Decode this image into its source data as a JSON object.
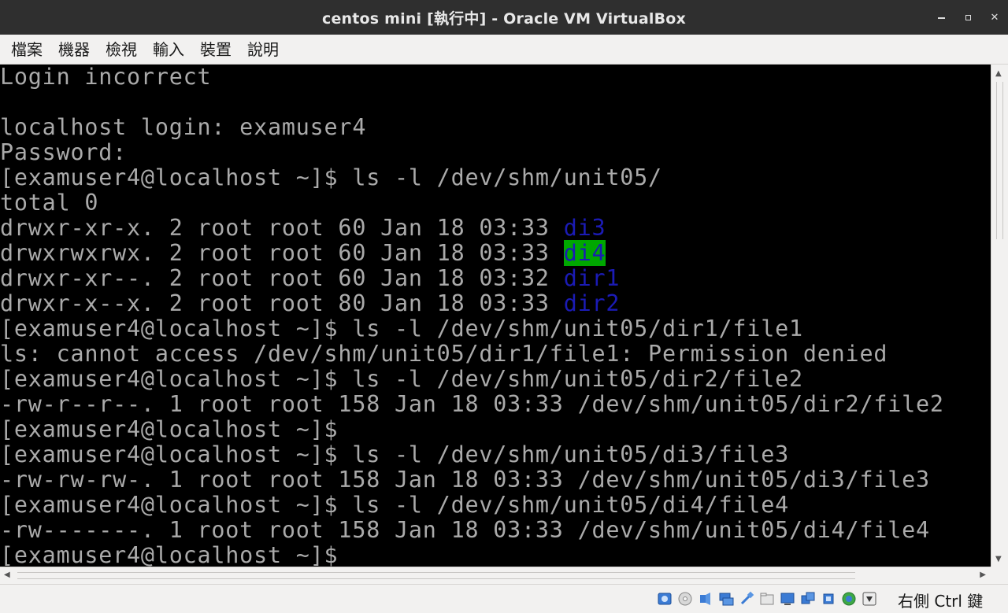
{
  "window": {
    "title": "centos mini [執行中] - Oracle VM VirtualBox"
  },
  "menu": [
    "檔案",
    "機器",
    "檢視",
    "輸入",
    "裝置",
    "說明"
  ],
  "terminal": {
    "lines": [
      {
        "text": "Login incorrect"
      },
      {
        "text": ""
      },
      {
        "text": "localhost login: examuser4"
      },
      {
        "text": "Password:"
      },
      {
        "text": "[examuser4@localhost ~]$ ls -l /dev/shm/unit05/"
      },
      {
        "text": "total 0"
      },
      {
        "text": "drwxr-xr-x. 2 root root 60 Jan 18 03:33 ",
        "dir": "di3",
        "style": "dirblue"
      },
      {
        "text": "drwxrwxrwx. 2 root root 60 Jan 18 03:33 ",
        "dir": "di4",
        "style": "dirhl"
      },
      {
        "text": "drwxr-xr--. 2 root root 60 Jan 18 03:32 ",
        "dir": "dir1",
        "style": "dirblue"
      },
      {
        "text": "drwxr-x--x. 2 root root 80 Jan 18 03:33 ",
        "dir": "dir2",
        "style": "dirblue"
      },
      {
        "text": "[examuser4@localhost ~]$ ls -l /dev/shm/unit05/dir1/file1"
      },
      {
        "text": "ls: cannot access /dev/shm/unit05/dir1/file1: Permission denied"
      },
      {
        "text": "[examuser4@localhost ~]$ ls -l /dev/shm/unit05/dir2/file2"
      },
      {
        "text": "-rw-r--r--. 1 root root 158 Jan 18 03:33 /dev/shm/unit05/dir2/file2"
      },
      {
        "text": "[examuser4@localhost ~]$"
      },
      {
        "text": "[examuser4@localhost ~]$ ls -l /dev/shm/unit05/di3/file3"
      },
      {
        "text": "-rw-rw-rw-. 1 root root 158 Jan 18 03:33 /dev/shm/unit05/di3/file3"
      },
      {
        "text": "[examuser4@localhost ~]$ ls -l /dev/shm/unit05/di4/file4"
      },
      {
        "text": "-rw-------. 1 root root 158 Jan 18 03:33 /dev/shm/unit05/di4/file4"
      },
      {
        "text": "[examuser4@localhost ~]$"
      }
    ],
    "colors": {
      "fg": "#aaaaaa",
      "bg": "#000000",
      "dir": "#1b1bb5",
      "highlight_bg": "#00a800"
    }
  },
  "status": {
    "icons": [
      "hard-disk-icon",
      "optical-drive-icon",
      "audio-icon",
      "network-icon",
      "usb-icon",
      "shared-folders-icon",
      "display-icon",
      "video-capture-icon",
      "cpu-icon",
      "mouse-integration-icon",
      "arrow-down-icon"
    ],
    "host_key": "右側 Ctrl 鍵"
  }
}
